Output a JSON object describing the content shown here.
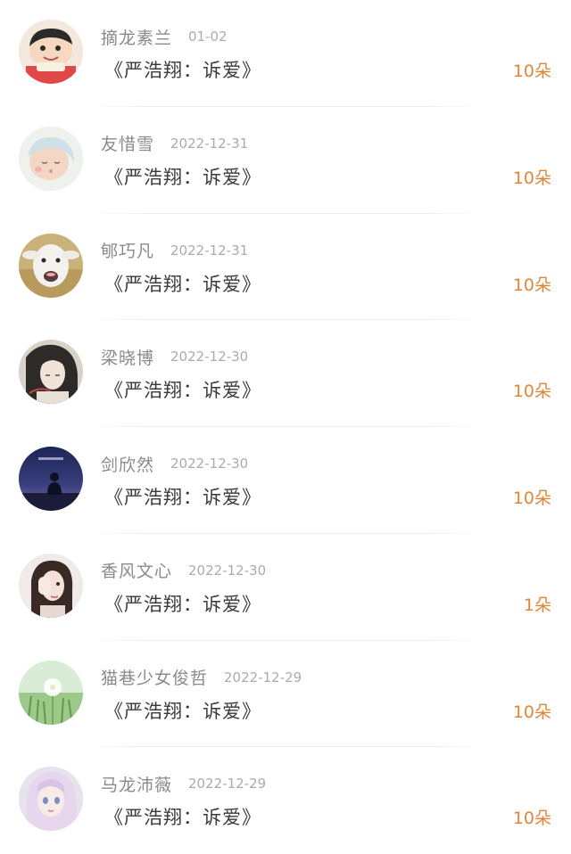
{
  "gift_list": {
    "items": [
      {
        "name": "摘龙素兰",
        "date": "01-02",
        "gift": "《严浩翔：诉爱》",
        "count": "10朵",
        "avatar_icon": "crayon-shinchan-avatar-icon"
      },
      {
        "name": "友惜雪",
        "date": "2022-12-31",
        "gift": "《严浩翔：诉爱》",
        "count": "10朵",
        "avatar_icon": "baby-avatar-icon"
      },
      {
        "name": "郇巧凡",
        "date": "2022-12-31",
        "gift": "《严浩翔：诉爱》",
        "count": "10朵",
        "avatar_icon": "goat-avatar-icon"
      },
      {
        "name": "梁晓博",
        "date": "2022-12-30",
        "gift": "《严浩翔：诉爱》",
        "count": "10朵",
        "avatar_icon": "anime-character-avatar-icon"
      },
      {
        "name": "剑欣然",
        "date": "2022-12-30",
        "gift": "《严浩翔：诉爱》",
        "count": "10朵",
        "avatar_icon": "night-silhouette-avatar-icon"
      },
      {
        "name": "香风文心",
        "date": "2022-12-30",
        "gift": "《严浩翔：诉爱》",
        "count": "1朵",
        "avatar_icon": "girl-portrait-avatar-icon"
      },
      {
        "name": "猫巷少女俊哲",
        "date": "2022-12-29",
        "gift": "《严浩翔：诉爱》",
        "count": "10朵",
        "avatar_icon": "dandelion-avatar-icon"
      },
      {
        "name": "马龙沛薇",
        "date": "2022-12-29",
        "gift": "《严浩翔：诉爱》",
        "count": "10朵",
        "avatar_icon": "anime-girl-avatar-icon"
      }
    ]
  },
  "colors": {
    "count": "#e0863a",
    "name": "#8a8a8a",
    "date": "#ababab",
    "gift": "#3a3a3a"
  }
}
